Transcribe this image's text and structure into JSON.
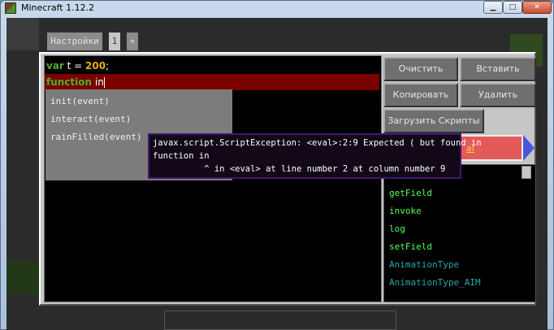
{
  "window": {
    "title": "Minecraft 1.12.2",
    "controls": {
      "minimize": "▁",
      "maximize": "□",
      "close": "✕"
    }
  },
  "tabs": [
    {
      "label": "Настройки"
    },
    {
      "label": "1"
    },
    {
      "label": "+"
    }
  ],
  "editor": {
    "line1": {
      "kw": "var",
      "rest": " t = ",
      "num": "200",
      "end": ";"
    },
    "line2": {
      "kw": "function",
      "rest": " in"
    }
  },
  "autocomplete": [
    "init(event)",
    "interact(event)",
    "rainFilled(event)"
  ],
  "error": {
    "line1": "javax.script.ScriptException: <eval>:2:9 Expected ( but found in",
    "line2": "function in",
    "line3": "          ^ in <eval> at line number 2 at column number 9"
  },
  "buttons": {
    "clear": "Очистить",
    "paste": "Вставить",
    "copy": "Копировать",
    "delete": "Удалить",
    "load_scripts": "Загрузить Скрипты"
  },
  "script_select": {
    "value": "al"
  },
  "function_list": [
    {
      "label": "getField",
      "color": "#55ff55"
    },
    {
      "label": "invoke",
      "color": "#55ff55"
    },
    {
      "label": "log",
      "color": "#55ff55"
    },
    {
      "label": "setField",
      "color": "#55ff55"
    },
    {
      "label": "AnimationType",
      "color": "#2aa8a8"
    },
    {
      "label": "AnimationType_AIM",
      "color": "#2aa8a8"
    }
  ]
}
